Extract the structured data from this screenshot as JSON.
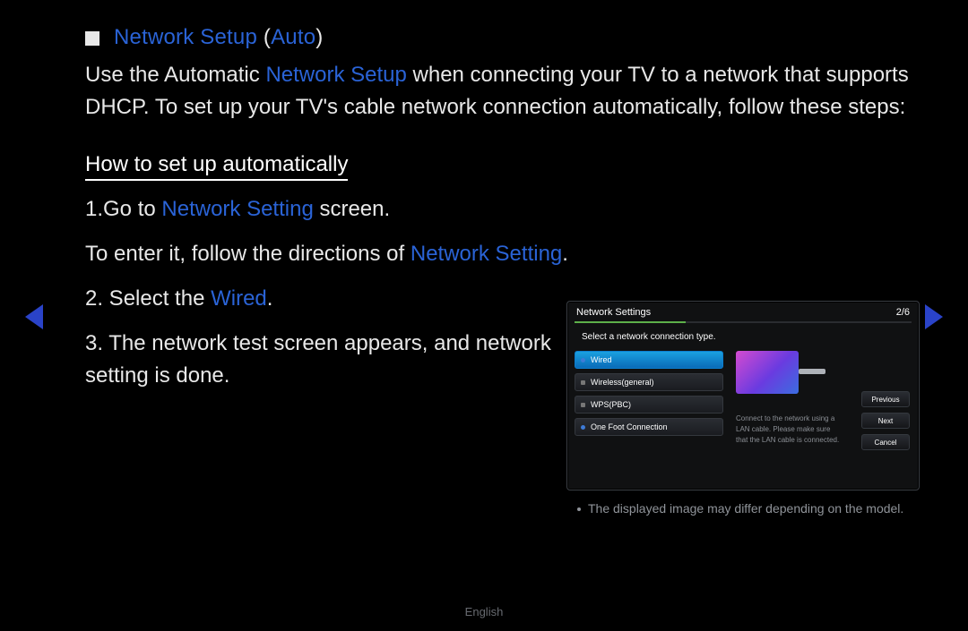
{
  "title": {
    "main": "Network Setup",
    "paren_open": " (",
    "auto": "Auto",
    "paren_close": ")"
  },
  "intro": {
    "p1a": "Use the Automatic ",
    "p1b": "Network Setup",
    "p1c": " when connecting your TV to a network that supports DHCP. To set up your TV's cable network connection automatically, follow these steps:"
  },
  "subhead": "How to set up automatically",
  "steps": {
    "s1a": "1.Go to ",
    "s1b": "Network Setting",
    "s1c": " screen.",
    "s2a": "To enter it, follow the directions of ",
    "s2b": "Network Setting",
    "s2c": ".",
    "s3a": "2. Select the ",
    "s3b": "Wired",
    "s3c": ".",
    "s4": "3. The network test screen appears, and network setting is done."
  },
  "panel": {
    "title": "Network Settings",
    "page": "2/6",
    "subtitle": "Select a network connection type.",
    "options": [
      "Wired",
      "Wireless(general)",
      "WPS(PBC)",
      "One Foot Connection"
    ],
    "help": "Connect to the network using a LAN cable. Please make sure that the LAN cable is connected.",
    "buttons": [
      "Previous",
      "Next",
      "Cancel"
    ]
  },
  "caption": "The displayed image may differ depending on the model.",
  "footer": "English"
}
